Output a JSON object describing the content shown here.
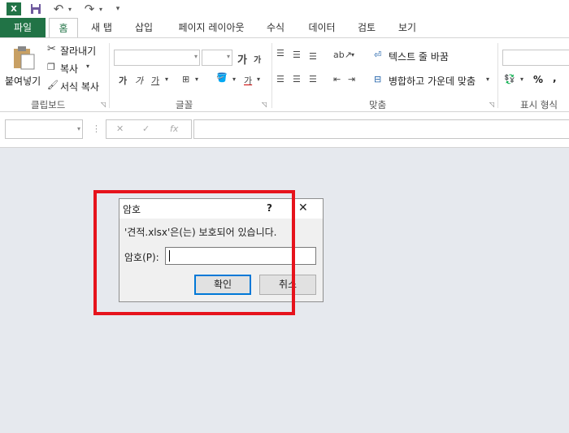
{
  "qat": {
    "excel_icon": "excel-logo-icon",
    "save_icon": "save-icon",
    "undo": "↶",
    "redo": "↷",
    "customize": "▾"
  },
  "tabs": [
    {
      "label": "파일"
    },
    {
      "label": "홈"
    },
    {
      "label": "새 탭"
    },
    {
      "label": "삽입"
    },
    {
      "label": "페이지 레이아웃"
    },
    {
      "label": "수식"
    },
    {
      "label": "데이터"
    },
    {
      "label": "검토"
    },
    {
      "label": "보기"
    }
  ],
  "clipboard": {
    "paste": "붙여넣기",
    "cut": "잘라내기",
    "copy": "복사",
    "format_painter": "서식 복사",
    "group": "클립보드"
  },
  "font": {
    "grow": "가",
    "shrink": "가",
    "bold": "가",
    "italic": "가",
    "underline": "가",
    "font_color": "가",
    "group": "글꼴"
  },
  "alignment": {
    "wrap_text": "텍스트 줄 바꿈",
    "merge_center": "병합하고 가운데 맞춤",
    "group": "맞춤"
  },
  "number": {
    "percent": "%",
    "comma": ",",
    "group": "표시 형식"
  },
  "formula_bar": {
    "cancel": "✕",
    "enter": "✓",
    "fx": "fx",
    "name_box": "",
    "formula": ""
  },
  "dialog": {
    "title": "암호",
    "help": "?",
    "close": "✕",
    "message": "'견적.xlsx'은(는) 보호되어 있습니다.",
    "password_label": "암호(P):",
    "password_value": "",
    "ok": "확인",
    "cancel": "취소"
  },
  "colors": {
    "excel_green": "#217346",
    "highlight_red": "#e6131c"
  }
}
